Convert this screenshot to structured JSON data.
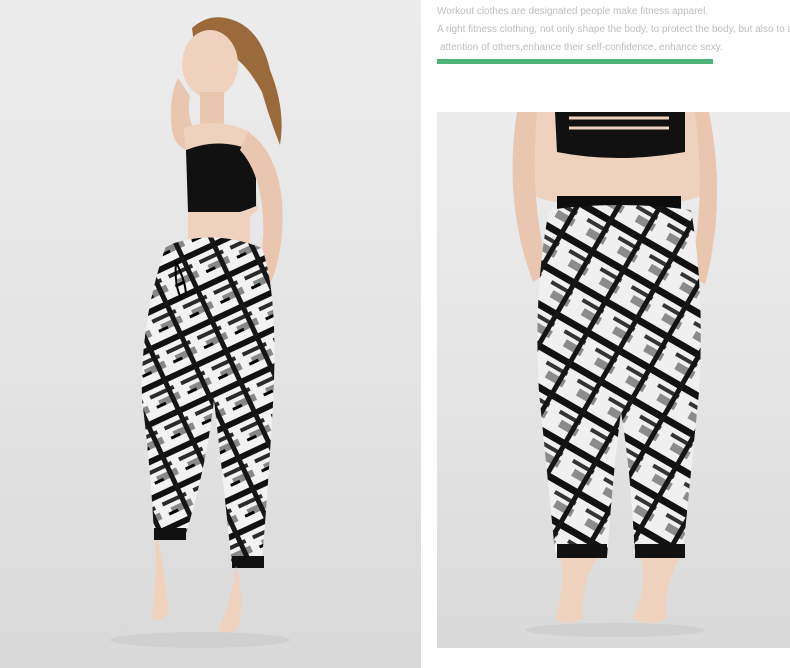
{
  "headline": {
    "line1": "Workout clothes are designated people make fitness apparel.",
    "line2": "A right fitness clothing, not only shape the body, to protect the body, but also to attr",
    "line3": "attention of others,enhance their self-confidence, enhance sexy."
  },
  "colors": {
    "accent_rule": "#4fb37c",
    "text_gray": "#bdbdbd",
    "studio_background": "#e5e5e5",
    "garment_black": "#111111",
    "print_white": "#f5f5f5",
    "print_gray": "#8b8b8b",
    "skin": "#efd2bd",
    "hair": "#9a6a3a"
  },
  "images": [
    {
      "label": "model-side-view",
      "description_icon": "photo-icon"
    },
    {
      "label": "model-back-view",
      "description_icon": "photo-icon"
    }
  ]
}
